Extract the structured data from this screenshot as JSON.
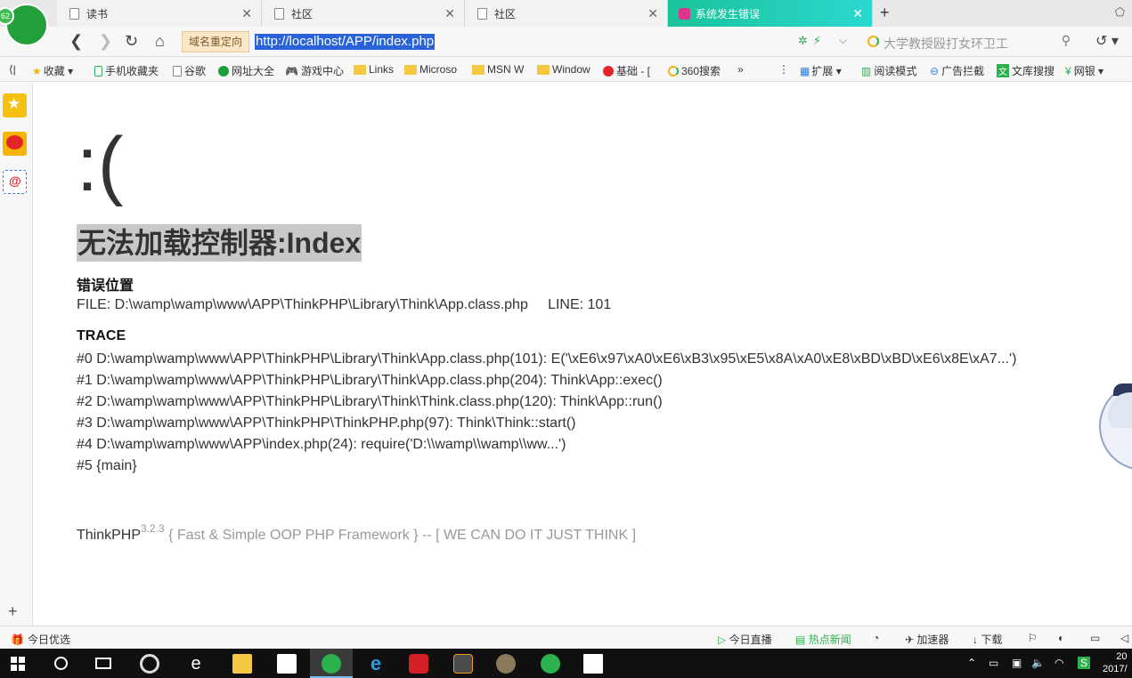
{
  "tabs": [
    {
      "label": "读书"
    },
    {
      "label": "社区"
    },
    {
      "label": "社区"
    },
    {
      "label": "系统发生错误"
    }
  ],
  "browser_badge": "62",
  "address": {
    "redirect_label": "域名重定向",
    "url": "http://localhost/APP/index.php"
  },
  "search": {
    "placeholder": "大学教授殴打女环卫工"
  },
  "bookmarks": [
    {
      "label": "收藏"
    },
    {
      "label": "手机收藏夹"
    },
    {
      "label": "谷歌"
    },
    {
      "label": "网址大全"
    },
    {
      "label": "游戏中心"
    },
    {
      "label": "Links"
    },
    {
      "label": "Microso"
    },
    {
      "label": "MSN W"
    },
    {
      "label": "Window"
    },
    {
      "label": "基础 - ["
    },
    {
      "label": "360搜索"
    }
  ],
  "bookbar_right": [
    {
      "label": "扩展"
    },
    {
      "label": "阅读模式"
    },
    {
      "label": "广告拦截"
    },
    {
      "label": "文库搜搜"
    },
    {
      "label": "网银"
    }
  ],
  "page": {
    "face": ":(",
    "title": "无法加载控制器:Index",
    "location_heading": "错误位置",
    "file_line": "FILE: D:\\wamp\\wamp\\www\\APP\\ThinkPHP\\Library\\Think\\App.class.php     LINE: 101",
    "trace_heading": "TRACE",
    "trace": [
      "#0 D:\\wamp\\wamp\\www\\APP\\ThinkPHP\\Library\\Think\\App.class.php(101): E('\\xE6\\x97\\xA0\\xE6\\xB3\\x95\\xE5\\x8A\\xA0\\xE8\\xBD\\xBD\\xE6\\x8E\\xA7...')",
      "#1 D:\\wamp\\wamp\\www\\APP\\ThinkPHP\\Library\\Think\\App.class.php(204): Think\\App::exec()",
      "#2 D:\\wamp\\wamp\\www\\APP\\ThinkPHP\\Library\\Think\\Think.class.php(120): Think\\App::run()",
      "#3 D:\\wamp\\wamp\\www\\APP\\ThinkPHP\\ThinkPHP.php(97): Think\\Think::start()",
      "#4 D:\\wamp\\wamp\\www\\APP\\index.php(24): require('D:\\\\wamp\\\\wamp\\\\ww...')",
      "#5 {main}"
    ],
    "framework": "ThinkPHP",
    "version": "3.2.3",
    "slogan": " { Fast & Simple OOP PHP Framework } -- [ WE CAN DO IT JUST THINK ]"
  },
  "statusbar": {
    "left": "今日优选",
    "live": "今日直播",
    "news": "热点新闻",
    "accelerator": "加速器",
    "download": "下载"
  },
  "taskbar": {
    "clock_line1": "20",
    "clock_line2": "2017/"
  }
}
